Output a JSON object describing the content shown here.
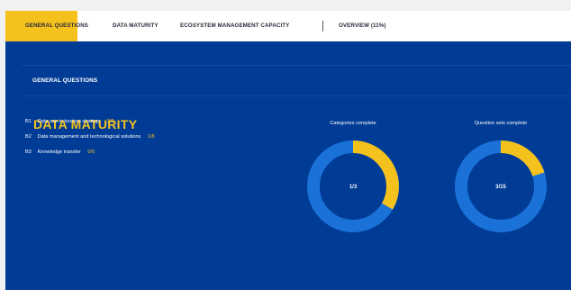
{
  "tabs": [
    {
      "label": "GENERAL QUESTIONS",
      "active": true
    },
    {
      "label": "DATA MATURITY"
    },
    {
      "label": "ECOSYSTEM MANAGEMENT CAPACITY"
    },
    {
      "label": "OVERVIEW (11%)"
    }
  ],
  "section_label": "GENERAL QUESTIONS",
  "title": "DATA MATURITY",
  "items": [
    {
      "code": "B1",
      "label": "Data use in tourism strategy",
      "progress": "2/2"
    },
    {
      "code": "B2",
      "label": "Data management and technological solutions",
      "progress": "1/8"
    },
    {
      "code": "B3",
      "label": "Knowledge transfer",
      "progress": "0/5"
    }
  ],
  "charts": [
    {
      "title": "Categories complete",
      "center": "1/3",
      "fraction": 0.3333
    },
    {
      "title": "Question sets complete",
      "center": "3/15",
      "fraction": 0.2
    }
  ],
  "colors": {
    "accent": "#f5c21d",
    "panel": "#003b95",
    "ring": "#1a72d8"
  }
}
